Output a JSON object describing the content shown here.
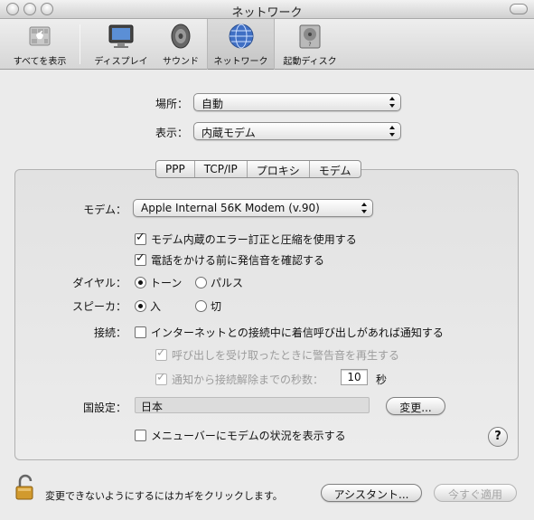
{
  "window": {
    "title": "ネットワーク"
  },
  "toolbar": {
    "items": [
      {
        "label": "すべてを表示",
        "icon": "apple-icon"
      },
      {
        "label": "ディスプレイ",
        "icon": "display-icon"
      },
      {
        "label": "サウンド",
        "icon": "speaker-icon"
      },
      {
        "label": "ネットワーク",
        "icon": "network-globe-icon"
      },
      {
        "label": "起動ディスク",
        "icon": "startup-disk-icon"
      }
    ],
    "selected": "ネットワーク"
  },
  "location": {
    "label": "場所：",
    "value": "自動"
  },
  "show": {
    "label": "表示：",
    "value": "内蔵モデム"
  },
  "tabs": [
    "PPP",
    "TCP/IP",
    "プロキシ",
    "モデム"
  ],
  "selected_tab": "モデム",
  "modem": {
    "label": "モデム：",
    "value": "Apple Internal 56K Modem (v.90)",
    "error_correction": {
      "label": "モデム内蔵のエラー訂正と圧縮を使用する",
      "checked": true
    },
    "dial_tone": {
      "label": "電話をかける前に発信音を確認する",
      "checked": true
    },
    "dial": {
      "label": "ダイヤル：",
      "options": [
        "トーン",
        "パルス"
      ],
      "selected": "トーン"
    },
    "speaker": {
      "label": "スピーカ：",
      "options": [
        "入",
        "切"
      ],
      "selected": "入"
    },
    "connection": {
      "label": "接続：",
      "notify": {
        "label": "インターネットとの接続中に着信呼び出しがあれば通知する",
        "checked": false
      },
      "play_alert": {
        "label": "呼び出しを受け取ったときに警告音を再生する",
        "checked": true,
        "disabled": true
      },
      "seconds": {
        "label": "通知から接続解除までの秒数：",
        "value": "10",
        "unit": "秒",
        "checked": true,
        "disabled": true
      }
    },
    "country": {
      "label": "国設定：",
      "value": "日本",
      "change_button": "変更..."
    },
    "menubar_status": {
      "label": "メニューバーにモデムの状況を表示する",
      "checked": false
    }
  },
  "help_label": "?",
  "footer": {
    "lock_text": "変更できないようにするにはカギをクリックします。",
    "assistant_button": "アシスタント...",
    "apply_button": "今すぐ適用"
  }
}
